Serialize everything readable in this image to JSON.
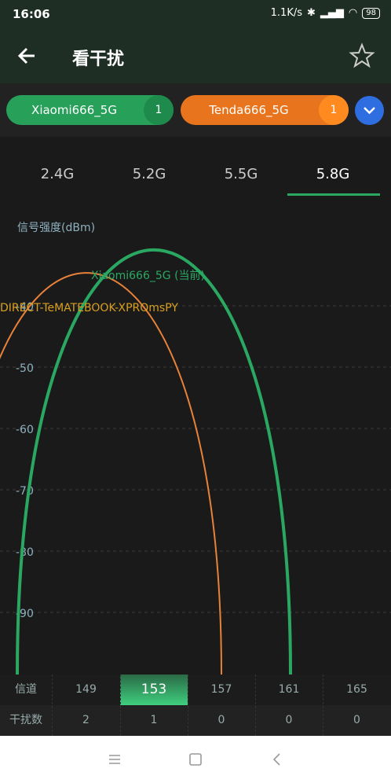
{
  "status": {
    "time": "16:06",
    "network_speed": "1.1K/s",
    "battery": "98"
  },
  "appbar": {
    "title": "看干扰"
  },
  "chips": [
    {
      "label": "Xiaomi666_5G",
      "count": "1",
      "color": "#27a05a"
    },
    {
      "label": "Tenda666_5G",
      "count": "1",
      "color": "#e8751e"
    }
  ],
  "tabs": [
    "2.4G",
    "5.2G",
    "5.5G",
    "5.8G"
  ],
  "selected_tab": "5.8G",
  "chart_data": {
    "type": "line",
    "ylabel": "信号强度(dBm)",
    "y_ticks": [
      "-40",
      "-50",
      "-60",
      "-70",
      "-80",
      "-90"
    ],
    "x_channels": [
      "149",
      "153",
      "157",
      "161",
      "165"
    ],
    "grid": true,
    "series": [
      {
        "name": "Xiaomi666_5G (当前)",
        "color": "#2aa862",
        "center_channel": 153,
        "peak_dbm": -36
      },
      {
        "name": "DIRECT-TeMATEBOOK-XPROmsPY",
        "color": "#e8823a",
        "center_channel": 149,
        "peak_dbm": -41
      }
    ]
  },
  "table": {
    "row1_label": "信道",
    "row2_label": "干扰数",
    "channels": [
      "149",
      "153",
      "157",
      "161",
      "165"
    ],
    "interference": [
      "2",
      "1",
      "0",
      "0",
      "0"
    ],
    "selected_channel": "153"
  }
}
